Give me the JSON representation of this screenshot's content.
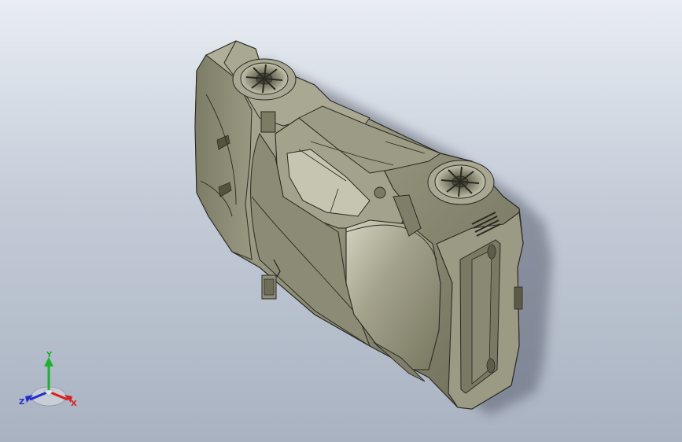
{
  "viewport": {
    "background_top": "#e9edf3",
    "background_bottom": "#a9b2c1",
    "model_color": "#8f8e78",
    "model_shadow": "#76765f",
    "model_highlight": "#c9c8b4",
    "edge_color": "#2a2a22"
  },
  "triad": {
    "x_label": "X",
    "y_label": "Y",
    "z_label": "Z",
    "x_color": "#d82020",
    "y_color": "#20b030",
    "z_color": "#2030d0"
  }
}
